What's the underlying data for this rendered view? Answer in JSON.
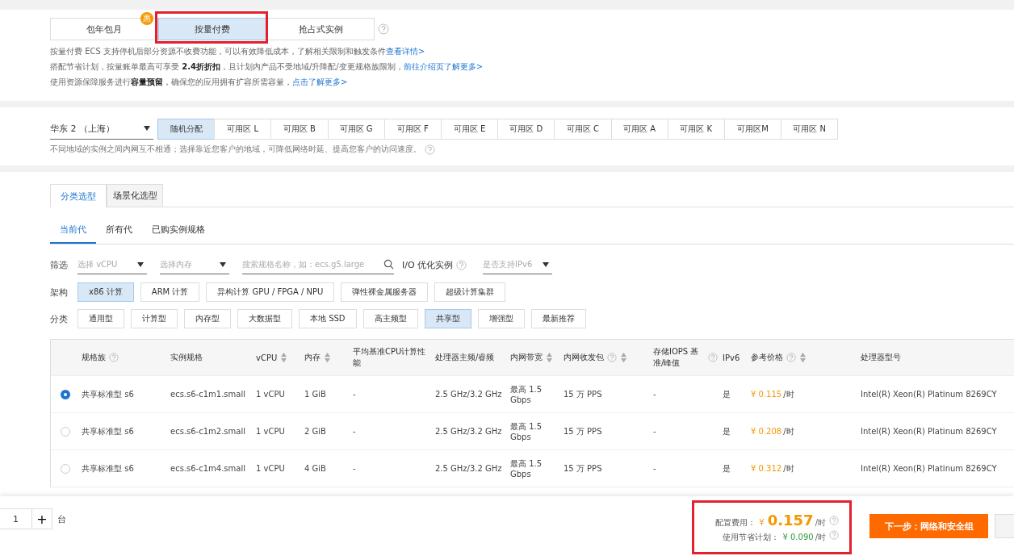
{
  "billing": {
    "tabs": [
      {
        "label": "包年包月",
        "selected": false,
        "badge": "惠"
      },
      {
        "label": "按量付费",
        "selected": true
      },
      {
        "label": "抢占式实例",
        "selected": false
      }
    ],
    "notes": [
      {
        "text": "按量付费 ECS 支持停机后部分资源不收费功能，可以有效降低成本，了解相关限制和触发条件",
        "link": "查看详情>"
      },
      {
        "text": "搭配节省计划，按量账单最高可享受 **2.4折折扣**，且计划内产品不受地域/升降配/变更规格族限制，",
        "link": "前往介绍页了解更多>"
      },
      {
        "text": "使用资源保障服务进行**容量预留**，确保您的应用拥有扩容所需容量，",
        "link": "点击了解更多>"
      }
    ]
  },
  "region": {
    "select": "华东 2 （上海）",
    "zones": [
      {
        "label": "随机分配",
        "selected": true
      },
      {
        "label": "可用区 L",
        "selected": false
      },
      {
        "label": "可用区 B",
        "selected": false
      },
      {
        "label": "可用区 G",
        "selected": false
      },
      {
        "label": "可用区 F",
        "selected": false
      },
      {
        "label": "可用区 E",
        "selected": false
      },
      {
        "label": "可用区 D",
        "selected": false
      },
      {
        "label": "可用区 C",
        "selected": false
      },
      {
        "label": "可用区 A",
        "selected": false
      },
      {
        "label": "可用区 K",
        "selected": false
      },
      {
        "label": "可用区M",
        "selected": false
      },
      {
        "label": "可用区 N",
        "selected": false
      }
    ],
    "hint": "不同地域的实例之间内网互不相通；选择靠近您客户的地域，可降低网络时延、提高您客户的访问速度。"
  },
  "selector_tabs": [
    {
      "label": "分类选型",
      "selected": true
    },
    {
      "label": "场景化选型",
      "selected": false
    }
  ],
  "generation_tabs": [
    {
      "label": "当前代",
      "selected": true
    },
    {
      "label": "所有代",
      "selected": false
    },
    {
      "label": "已购实例规格",
      "selected": false
    }
  ],
  "filters": {
    "label": "筛选",
    "fields": [
      {
        "kind": "select",
        "placeholder": "选择 vCPU"
      },
      {
        "kind": "select",
        "placeholder": "选择内存"
      },
      {
        "kind": "search",
        "placeholder": "搜索规格名称，如：ecs.g5.large"
      },
      {
        "kind": "check",
        "label": "I/O 优化实例"
      },
      {
        "kind": "select",
        "placeholder": "是否支持IPv6"
      }
    ]
  },
  "architecture": {
    "label": "架构",
    "options": [
      {
        "label": "x86 计算",
        "selected": true
      },
      {
        "label": "ARM 计算",
        "selected": false
      },
      {
        "label": "异构计算 GPU / FPGA / NPU",
        "selected": false
      },
      {
        "label": "弹性裸金属服务器",
        "selected": false
      },
      {
        "label": "超级计算集群",
        "selected": false
      }
    ]
  },
  "category": {
    "label": "分类",
    "options": [
      {
        "label": "通用型",
        "selected": false
      },
      {
        "label": "计算型",
        "selected": false
      },
      {
        "label": "内存型",
        "selected": false
      },
      {
        "label": "大数据型",
        "selected": false
      },
      {
        "label": "本地 SSD",
        "selected": false
      },
      {
        "label": "高主频型",
        "selected": false
      },
      {
        "label": "共享型",
        "selected": true
      },
      {
        "label": "增强型",
        "selected": false
      },
      {
        "label": "最新推荐",
        "selected": false
      }
    ]
  },
  "table": {
    "columns": [
      {
        "label": "规格族",
        "help": true,
        "sortable": false
      },
      {
        "label": "实例规格",
        "help": false,
        "sortable": false
      },
      {
        "label": "vCPU",
        "help": false,
        "sortable": true
      },
      {
        "label": "内存",
        "help": false,
        "sortable": true
      },
      {
        "label": "平均基准CPU计算性能",
        "help": false,
        "sortable": false
      },
      {
        "label": "处理器主频/睿频",
        "help": false,
        "sortable": false
      },
      {
        "label": "内网带宽",
        "help": false,
        "sortable": true
      },
      {
        "label": "内网收发包",
        "help": true,
        "sortable": true
      },
      {
        "label": "存储IOPS 基准/峰值",
        "help": true,
        "sortable": false
      },
      {
        "label": "IPv6",
        "help": false,
        "sortable": false
      },
      {
        "label": "参考价格",
        "help": true,
        "sortable": true
      },
      {
        "label": "处理器型号",
        "help": false,
        "sortable": false
      }
    ],
    "rows": [
      {
        "selected": true,
        "cells": [
          "共享标准型 s6",
          "ecs.s6-c1m1.small",
          "1 vCPU",
          "1 GiB",
          "-",
          "2.5 GHz/3.2 GHz",
          "最高 1.5 Gbps",
          "15 万 PPS",
          "-",
          "是"
        ],
        "price": "¥ 0.115",
        "unit": "/时",
        "cpu": "Intel(R) Xeon(R) Platinum 8269CY"
      },
      {
        "selected": false,
        "cells": [
          "共享标准型 s6",
          "ecs.s6-c1m2.small",
          "1 vCPU",
          "2 GiB",
          "-",
          "2.5 GHz/3.2 GHz",
          "最高 1.5 Gbps",
          "15 万 PPS",
          "-",
          "是"
        ],
        "price": "¥ 0.208",
        "unit": "/时",
        "cpu": "Intel(R) Xeon(R) Platinum 8269CY"
      },
      {
        "selected": false,
        "cells": [
          "共享标准型 s6",
          "ecs.s6-c1m4.small",
          "1 vCPU",
          "4 GiB",
          "-",
          "2.5 GHz/3.2 GHz",
          "最高 1.5 Gbps",
          "15 万 PPS",
          "-",
          "是"
        ],
        "price": "¥ 0.312",
        "unit": "/时",
        "cpu": "Intel(R) Xeon(R) Platinum 8269CY"
      }
    ]
  },
  "footer": {
    "quantity": "1",
    "plus": "+",
    "unit": "台",
    "cost_label": "配置费用：",
    "currency": "¥",
    "cost": "0.157",
    "cost_unit": "/时",
    "plan_label": "使用节省计划：",
    "plan_cost": "¥ 0.090",
    "plan_unit": "/时",
    "next_button": "下一步：网络和安全组"
  }
}
